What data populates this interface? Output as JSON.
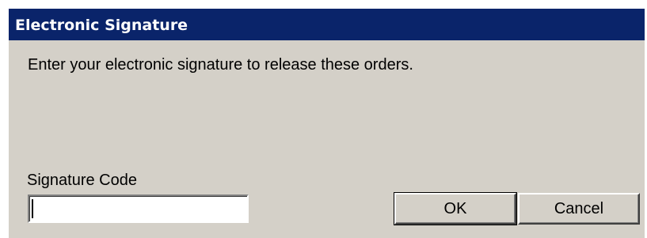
{
  "dialog": {
    "title": "Electronic Signature",
    "message": "Enter your electronic signature to release these orders.",
    "signature_label": "Signature Code",
    "signature_value": "",
    "ok_label": "OK",
    "cancel_label": "Cancel"
  },
  "colors": {
    "titlebar": "#0a246a",
    "dialog_background": "#d4d0c8"
  }
}
